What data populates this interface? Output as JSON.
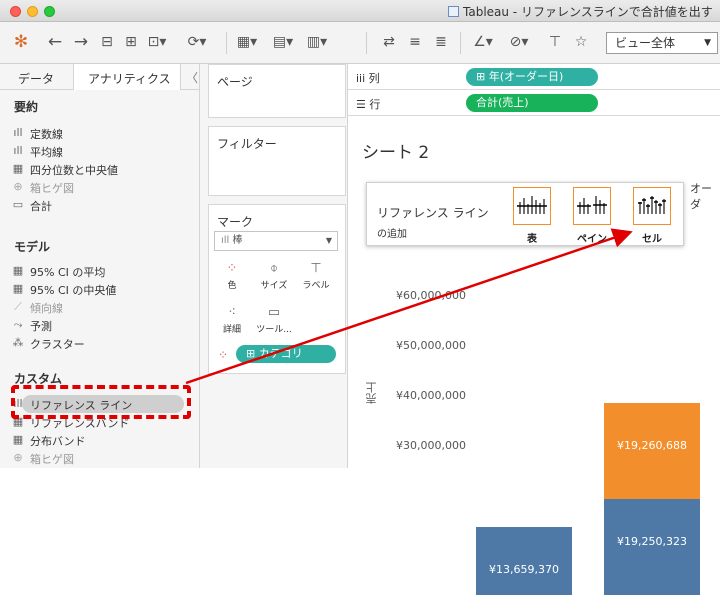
{
  "window": {
    "title": "Tableau - リファレンスラインで合計値を出す"
  },
  "toolbar": {
    "view_select": "ビュー全体"
  },
  "left_tabs": {
    "data": "データ",
    "analytics": "アナリティクス"
  },
  "analytics": {
    "summary_header": "要約",
    "summary_items": [
      {
        "label": "定数線",
        "icon": "bar-chart-icon",
        "dim": false
      },
      {
        "label": "平均線",
        "icon": "bar-chart-icon",
        "dim": false
      },
      {
        "label": "四分位数と中央値",
        "icon": "boxplot-icon",
        "dim": false
      },
      {
        "label": "箱ヒゲ図",
        "icon": "boxwhisker-icon",
        "dim": true
      },
      {
        "label": "合計",
        "icon": "total-icon",
        "dim": false
      }
    ],
    "model_header": "モデル",
    "model_items": [
      {
        "label": "95% CI の平均",
        "icon": "ci-icon",
        "dim": false
      },
      {
        "label": "95% CI の中央値",
        "icon": "ci-icon",
        "dim": false
      },
      {
        "label": "傾向線",
        "icon": "trend-icon",
        "dim": true
      },
      {
        "label": "予測",
        "icon": "forecast-icon",
        "dim": false
      },
      {
        "label": "クラスター",
        "icon": "cluster-icon",
        "dim": false
      }
    ],
    "custom_header": "カスタム",
    "custom_items": [
      {
        "label": "リファレンス ライン",
        "icon": "bar-chart-icon",
        "dim": false
      },
      {
        "label": "リファレンスバンド",
        "icon": "band-icon",
        "dim": false
      },
      {
        "label": "分布バンド",
        "icon": "distribution-icon",
        "dim": false
      },
      {
        "label": "箱ヒゲ図",
        "icon": "boxwhisker-icon",
        "dim": true
      }
    ]
  },
  "cards": {
    "pages": "ページ",
    "filters": "フィルター",
    "marks": "マーク",
    "mark_type": "棒",
    "mark_buttons": {
      "color": "色",
      "size": "サイズ",
      "label": "ラベル",
      "detail": "詳細",
      "tooltip": "ツール..."
    },
    "color_pill": "カテゴリ"
  },
  "shelves": {
    "columns_label": "列",
    "rows_label": "行",
    "columns_pill": "年(オーダー日)",
    "rows_pill": "合計(売上)"
  },
  "sheet": {
    "title": "シート 2",
    "col_header": "オーダ"
  },
  "popup": {
    "title": "リファレンス ライン",
    "subtitle": "の追加",
    "targets": [
      "表",
      "ペイン",
      "セル"
    ]
  },
  "chart_data": {
    "type": "bar",
    "ylabel": "売上",
    "yticks": [
      "¥60,000,000",
      "¥50,000,000",
      "¥40,000,000",
      "¥30,000,000"
    ],
    "ylim": [
      25500000,
      68000000
    ],
    "colors": {
      "blue": "#4e79a7",
      "orange": "#f28e2b"
    },
    "stacks": [
      {
        "segments": [
          {
            "value": 13659370,
            "label": "¥13,659,370",
            "color": "#4e79a7"
          }
        ]
      },
      {
        "segments": [
          {
            "value": 19250323,
            "label": "¥19,250,323",
            "color": "#4e79a7"
          },
          {
            "value": 19260688,
            "label": "¥19,260,688",
            "color": "#f28e2b"
          }
        ]
      }
    ]
  }
}
